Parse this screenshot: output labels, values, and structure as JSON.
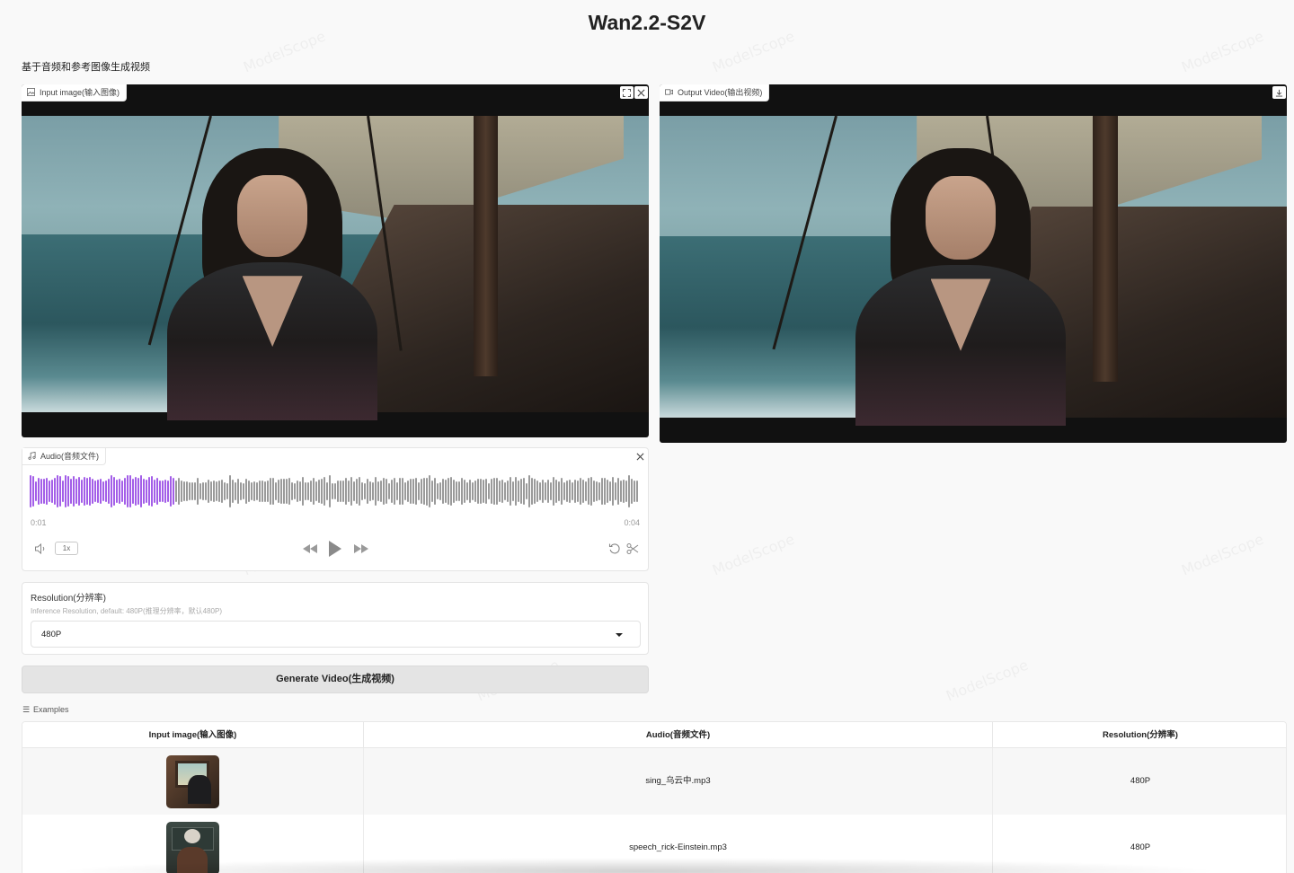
{
  "page": {
    "title": "Wan2.2-S2V",
    "subtitle": "基于音频和参考图像生成视频",
    "watermark_text": "ModelScope"
  },
  "input_image": {
    "label": "Input image(输入图像)",
    "icons": [
      "image-icon",
      "fullscreen-icon",
      "close-icon"
    ]
  },
  "output_video": {
    "label": "Output Video(输出视频)",
    "icons": [
      "video-icon",
      "download-icon"
    ]
  },
  "audio": {
    "label": "Audio(音频文件)",
    "current_time": "0:01",
    "duration": "0:04",
    "played_fraction": 0.24,
    "speed": "1x",
    "played_color": "#a35ee8",
    "unplayed_color": "#9a9a9a",
    "icons": [
      "music-icon",
      "close-icon",
      "volume-icon",
      "rewind-icon",
      "play-icon",
      "forward-icon",
      "reset-icon",
      "trim-icon"
    ]
  },
  "resolution": {
    "label": "Resolution(分辨率)",
    "info": "Inference Resolution, default: 480P(推理分辨率，默认480P)",
    "value": "480P"
  },
  "generate_button": {
    "label": "Generate Video(生成视频)"
  },
  "examples": {
    "label": "Examples",
    "columns": [
      "Input image(输入图像)",
      "Audio(音频文件)",
      "Resolution(分辨率)"
    ],
    "rows": [
      {
        "audio": "sing_乌云中.mp3",
        "resolution": "480P"
      },
      {
        "audio": "speech_rick-Einstein.mp3",
        "resolution": "480P"
      }
    ]
  }
}
